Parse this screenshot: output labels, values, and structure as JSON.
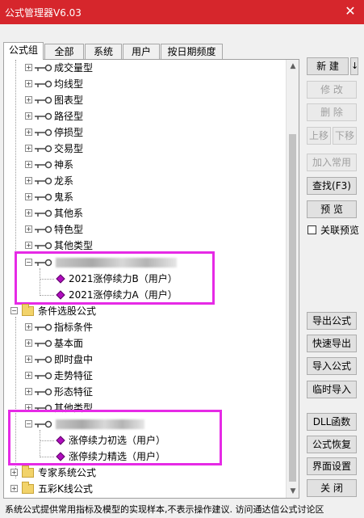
{
  "window": {
    "title": "公式管理器V6.03",
    "close_label": "✕"
  },
  "tabs": [
    "公式组",
    "全部",
    "系统",
    "用户",
    "按日期频度"
  ],
  "tree": {
    "group1": {
      "items": [
        "成交量型",
        "均线型",
        "图表型",
        "路径型",
        "停损型",
        "交易型",
        "神系",
        "龙系",
        "鬼系",
        "其他系",
        "特色型",
        "其他类型"
      ],
      "user_children": [
        "2021涨停续力B（用户）",
        "2021涨停续力A（用户）"
      ]
    },
    "group2": {
      "label": "条件选股公式",
      "items": [
        "指标条件",
        "基本面",
        "即时盘中",
        "走势特征",
        "形态特征",
        "其他类型"
      ],
      "user_children": [
        "涨停续力初选（用户）",
        "涨停续力精选（用户）"
      ]
    },
    "group3": {
      "label": "专家系统公式"
    },
    "group4": {
      "label": "五彩K线公式"
    }
  },
  "buttons": {
    "new": "新 建",
    "new_arrow": "↓",
    "modify": "修 改",
    "delete": "删 除",
    "move_up": "上移",
    "move_down": "下移",
    "add_common": "加入常用",
    "find": "查找(F3)",
    "preview": "预 览",
    "linked_preview": "关联预览",
    "export_formula": "导出公式",
    "quick_export": "快速导出",
    "import_formula": "导入公式",
    "temp_import": "临时导入",
    "dll_function": "DLL函数",
    "restore_formula": "公式恢复",
    "interface_settings": "界面设置",
    "close": "关 闭"
  },
  "status_text": "系统公式提供常用指标及模型的实现样本,不表示操作建议.  访问通达信公式讨论区",
  "colors": {
    "titlebar": "#d6262c",
    "highlight": "#e62ae6",
    "user_formula_icon": "#b00cbe"
  }
}
